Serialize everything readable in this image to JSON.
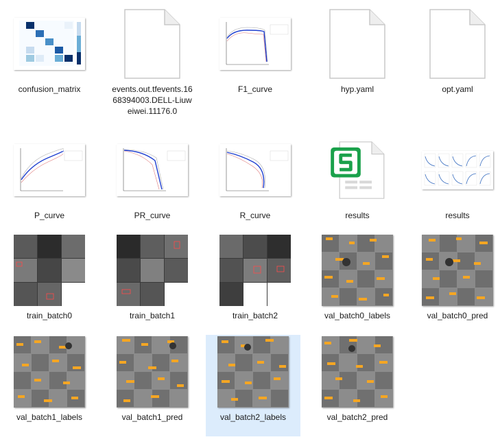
{
  "files": [
    {
      "name": "confusion_matrix",
      "icon": "confusion-matrix-thumbnail"
    },
    {
      "name": "events.out.tfevents.1668394003.DELL-Liuweiwei.11176.0",
      "icon": "blank-document-icon"
    },
    {
      "name": "F1_curve",
      "icon": "f1-curve-thumbnail"
    },
    {
      "name": "hyp.yaml",
      "icon": "blank-document-icon"
    },
    {
      "name": "opt.yaml",
      "icon": "blank-document-icon"
    },
    {
      "name": "P_curve",
      "icon": "p-curve-thumbnail"
    },
    {
      "name": "PR_curve",
      "icon": "pr-curve-thumbnail"
    },
    {
      "name": "R_curve",
      "icon": "r-curve-thumbnail"
    },
    {
      "name": "results",
      "icon": "spreadsheet-icon"
    },
    {
      "name": "results",
      "icon": "results-plot-thumbnail"
    },
    {
      "name": "train_batch0",
      "icon": "train-batch-thumbnail"
    },
    {
      "name": "train_batch1",
      "icon": "train-batch-thumbnail"
    },
    {
      "name": "train_batch2",
      "icon": "train-batch-thumbnail"
    },
    {
      "name": "val_batch0_labels",
      "icon": "val-batch-thumbnail"
    },
    {
      "name": "val_batch0_pred",
      "icon": "val-batch-thumbnail"
    },
    {
      "name": "val_batch1_labels",
      "icon": "val-batch-thumbnail"
    },
    {
      "name": "val_batch1_pred",
      "icon": "val-batch-thumbnail"
    },
    {
      "name": "val_batch2_labels",
      "icon": "val-batch-thumbnail",
      "selected": true
    },
    {
      "name": "val_batch2_pred",
      "icon": "val-batch-thumbnail"
    }
  ],
  "colors": {
    "selection": "#dcecfc",
    "spreadsheet_green": "#1aa14b",
    "heatmap_dark": "#08306b",
    "curve_blue": "#1f3fd0"
  }
}
